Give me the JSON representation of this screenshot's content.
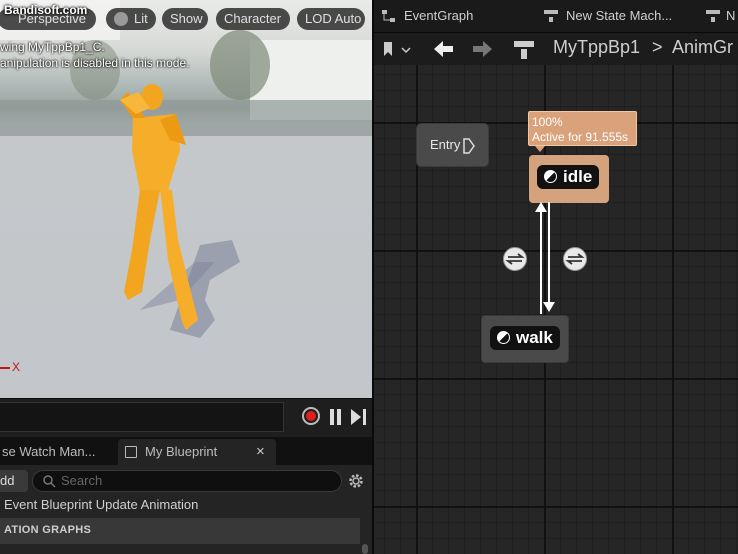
{
  "watermark": "Bandisoft.com",
  "viewport": {
    "buttons": {
      "perspective": "Perspective",
      "lit": "Lit",
      "show": "Show",
      "character": "Character",
      "lod": "LOD Auto"
    },
    "note_line1": "wing MyTppBp1_C.",
    "note_line2": "anipulation is disabled in this mode.",
    "axis_label": "X"
  },
  "bottom": {
    "tabs": {
      "watch": "se Watch Man...",
      "my_blueprint": "My Blueprint",
      "close": "×"
    },
    "add_label": "dd",
    "search_placeholder": "Search",
    "event_item": "Event Blueprint Update Animation",
    "section_header": "ATION GRAPHS"
  },
  "graph": {
    "tabs": {
      "event_graph": "EventGraph",
      "state_machine": "New State Mach...",
      "third": "N"
    },
    "breadcrumb": {
      "blueprint": "MyTppBp1",
      "separator": ">",
      "graph": "AnimGr"
    },
    "entry_label": "Entry",
    "tooltip": {
      "percent": "100%",
      "active": "Active for 91.555s"
    },
    "states": {
      "idle": "idle",
      "walk": "walk"
    }
  },
  "colors": {
    "idle_node": "#d4a27c",
    "tooltip_bg": "#d9a27a",
    "character": "#f5a623",
    "record": "#e01e1e"
  }
}
